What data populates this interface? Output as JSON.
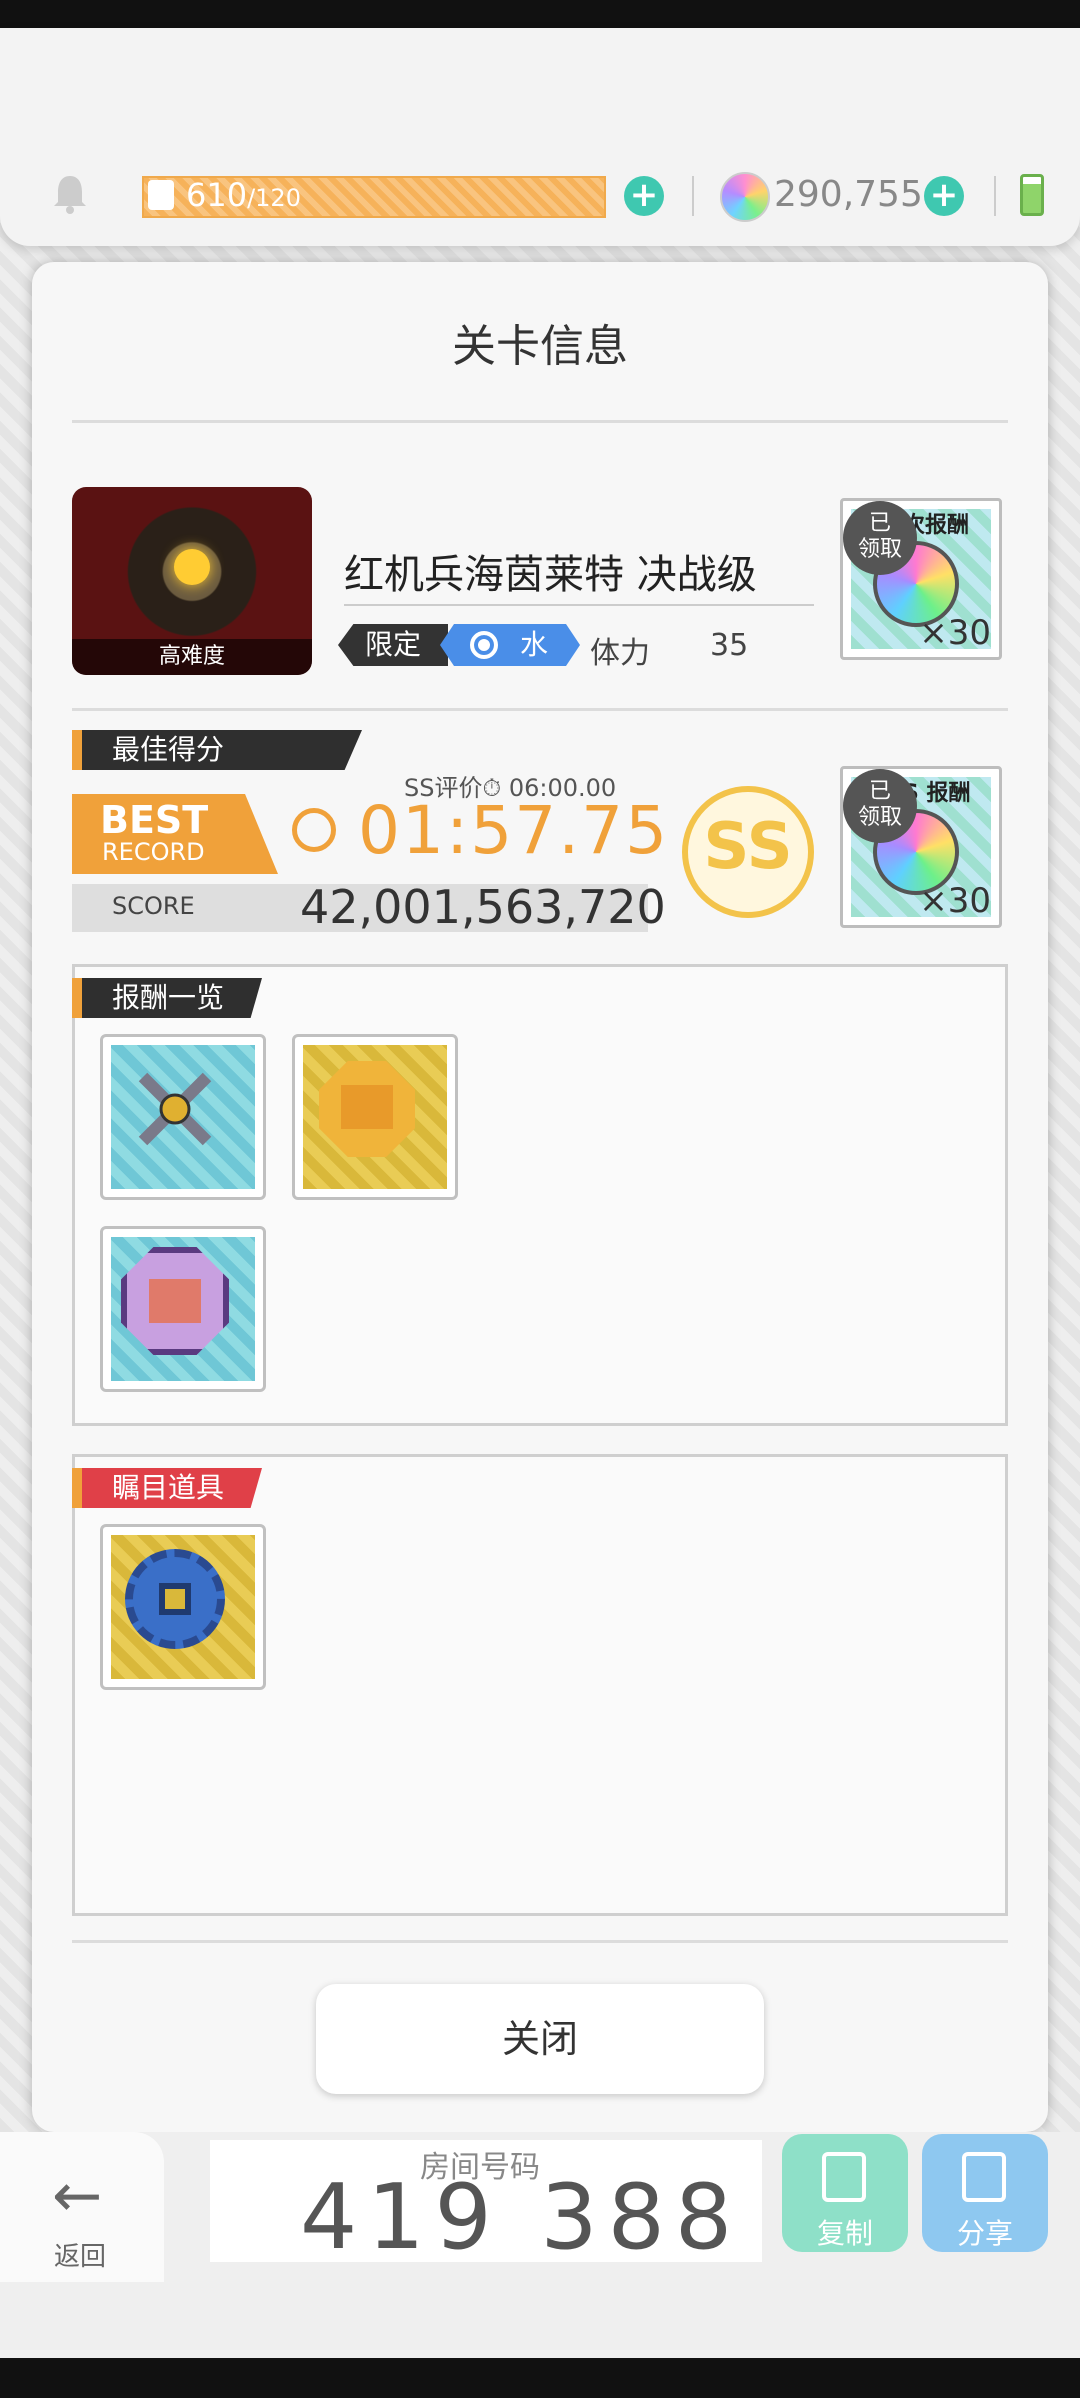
{
  "status": {
    "stamina_current": "610",
    "stamina_max": "/120",
    "gems": "290,755"
  },
  "dialog": {
    "title": "关卡信息",
    "stage": {
      "image_label": "高难度",
      "name": "红机兵海茵莱特 决战级",
      "tag_limited": "限定",
      "tag_element": "水",
      "stamina_label": "体力",
      "stamina_cost": "35"
    },
    "first_reward": {
      "header": "次报酬",
      "badge": "已\n领取",
      "quantity": "×30"
    },
    "best": {
      "section_label": "最佳得分",
      "badge_line1": "BEST",
      "badge_line2": "RECORD",
      "ss_eval": "SS评价⏱ 06:00.00",
      "time": "01:57.75",
      "score_label": "SCORE",
      "score_value": "42,001,563,720",
      "rank": "SS"
    },
    "score_reward": {
      "header": "S 报酬",
      "badge": "已\n领取",
      "quantity": "×30"
    },
    "rewards_section_label": "报酬一览",
    "eyecatch_section_label": "瞩目道具",
    "close_label": "关闭"
  },
  "bottom": {
    "back_label": "返回",
    "room_label": "房间号码",
    "room_number": "419 388",
    "copy_label": "复制",
    "share_label": "分享"
  },
  "colors": {
    "accent_orange": "#f0a13a",
    "water_blue": "#4a8ee8",
    "eyecatch_red": "#e04048",
    "plus_teal": "#3fc8b0"
  }
}
